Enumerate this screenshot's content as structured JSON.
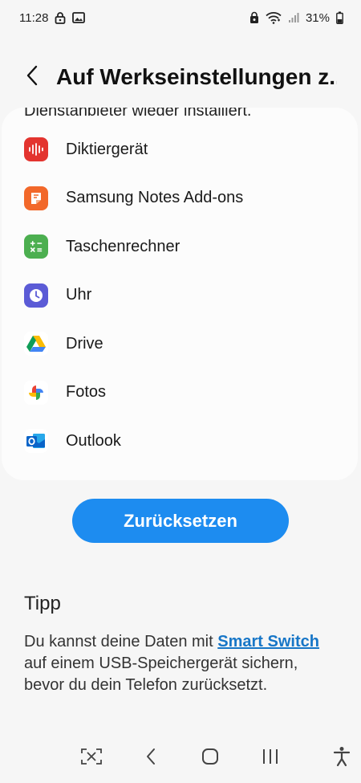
{
  "status_bar": {
    "time": "11:28",
    "battery": "31%",
    "icons_left": [
      "lock-icon",
      "gallery-icon"
    ],
    "icons_right": [
      "sync-lock-icon",
      "wifi-icon",
      "signal-icon",
      "battery-icon"
    ]
  },
  "header": {
    "title": "Auf Werkseinstellungen z..."
  },
  "card": {
    "intro_text": "Dienstanbieter wieder installiert.",
    "apps": [
      {
        "label": "Diktiergerät",
        "icon": "voice-recorder-icon",
        "color": "#e3342f"
      },
      {
        "label": "Samsung Notes Add-ons",
        "icon": "samsung-notes-icon",
        "color": "#f2682a"
      },
      {
        "label": "Taschenrechner",
        "icon": "calculator-icon",
        "color": "#4caf50"
      },
      {
        "label": "Uhr",
        "icon": "clock-icon",
        "color": "#5b5bd6"
      },
      {
        "label": "Drive",
        "icon": "google-drive-icon",
        "color": "#ffffff"
      },
      {
        "label": "Fotos",
        "icon": "google-photos-icon",
        "color": "#ffffff"
      },
      {
        "label": "Outlook",
        "icon": "outlook-icon",
        "color": "#0a64c8"
      }
    ]
  },
  "reset_button": {
    "label": "Zurücksetzen",
    "color": "#1d8cf0"
  },
  "tip": {
    "title": "Tipp",
    "text_before": "Du kannst deine Daten mit ",
    "link": "Smart Switch",
    "text_after": " auf einem USB-Speichergerät sichern, bevor du dein Telefon zurücksetzt."
  },
  "nav_bar": {
    "items": [
      "screenshot-capture-icon",
      "back-icon",
      "home-icon",
      "recents-icon",
      "accessibility-icon"
    ]
  }
}
